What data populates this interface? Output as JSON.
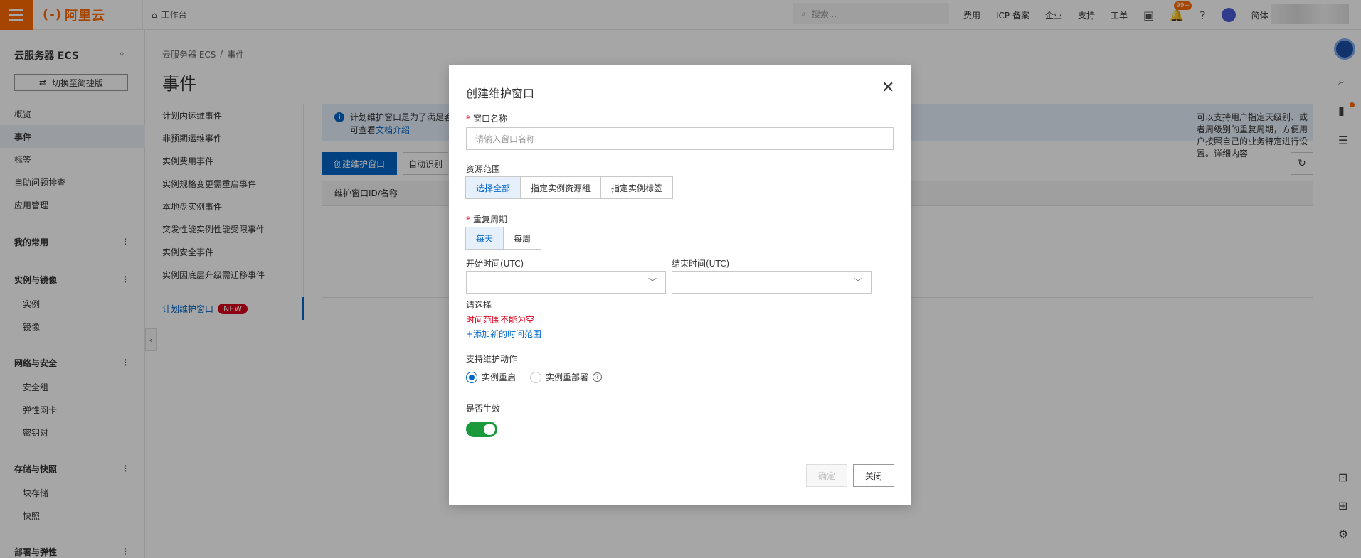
{
  "topbar": {
    "brand": "阿里云",
    "brand_mark": "(-)",
    "workbench": "工作台",
    "search_placeholder": "搜索...",
    "links": [
      "费用",
      "ICP 备案",
      "企业",
      "支持",
      "工单"
    ],
    "notification_badge": "99+",
    "language": "简体",
    "accent_color": "#ff6a00"
  },
  "sidebar": {
    "title": "云服务器 ECS",
    "switch_label": "切换至简捷版",
    "items": [
      {
        "label": "概览"
      },
      {
        "label": "事件"
      },
      {
        "label": "标签"
      },
      {
        "label": "自助问题排查"
      },
      {
        "label": "应用管理"
      },
      {
        "label": "我的常用"
      },
      {
        "label": "实例与镜像"
      },
      {
        "label": "实例"
      },
      {
        "label": "镜像"
      },
      {
        "label": "网络与安全"
      },
      {
        "label": "安全组"
      },
      {
        "label": "弹性网卡"
      },
      {
        "label": "密钥对"
      },
      {
        "label": "存储与快照"
      },
      {
        "label": "块存储"
      },
      {
        "label": "快照"
      },
      {
        "label": "部署与弹性"
      }
    ]
  },
  "main": {
    "breadcrumb": [
      "云服务器 ECS",
      "/",
      "事件"
    ],
    "title": "事件",
    "event_nav": [
      "计划内运维事件",
      "非预期运维事件",
      "实例费用事件",
      "实例规格变更需重启事件",
      "本地盘实例事件",
      "突发性能实例性能受限事件",
      "实例安全事件",
      "实例因底层升级需迁移事件"
    ],
    "active_nav": "计划维护窗口",
    "new_badge": "NEW",
    "info_line1_left": "计划维护窗口是为了满足客",
    "info_line1_right": "可以支持用户指定天级别、或者周级别的重复周期，方便用户按照自己的业务特定进行设置。详细内容",
    "info_line2_prefix": "可查看",
    "info_line2_link": "文档介绍",
    "create_button": "创建维护窗口",
    "auto_button": "自动识别",
    "table_header": "维护窗口ID/名称"
  },
  "modal": {
    "title": "创建维护窗口",
    "name_label": "窗口名称",
    "name_placeholder": "请输入窗口名称",
    "scope_label": "资源范围",
    "scope_options": [
      "选择全部",
      "指定实例资源组",
      "指定实例标签"
    ],
    "scope_selected": "选择全部",
    "repeat_label": "重复周期",
    "repeat_options": [
      "每天",
      "每周"
    ],
    "repeat_selected": "每天",
    "start_label": "开始时间(UTC)",
    "end_label": "结束时间(UTC)",
    "select_hint": "请选择",
    "error": "时间范围不能为空",
    "add_range": "+添加新的时间范围",
    "action_label": "支持维护动作",
    "action_options": [
      "实例重启",
      "实例重部署"
    ],
    "action_selected": "实例重启",
    "effective_label": "是否生效",
    "effective_on": true,
    "ok_button": "确定",
    "close_button": "关闭"
  }
}
